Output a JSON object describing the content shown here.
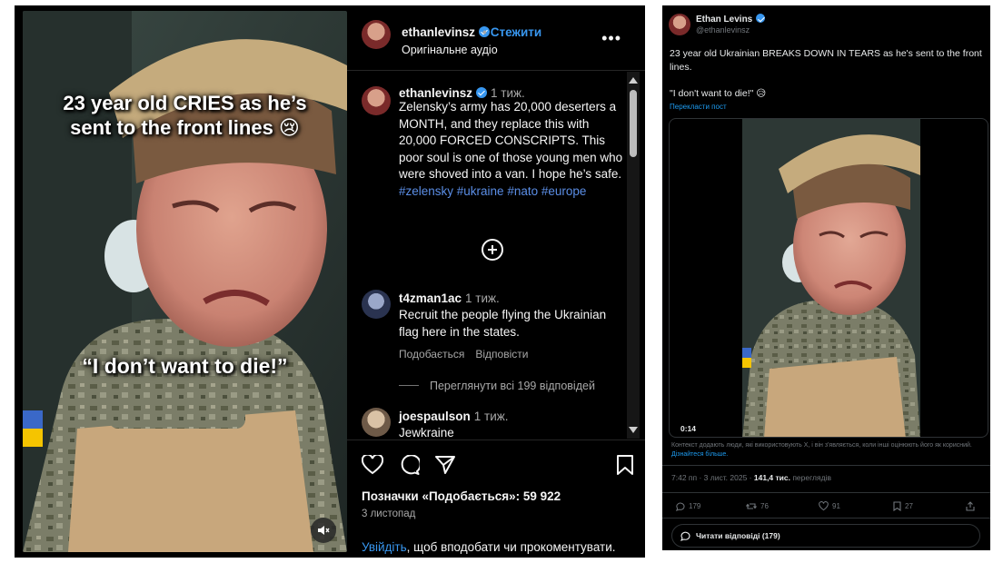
{
  "instagram": {
    "video": {
      "caption_top_line1": "23 year old CRIES as he’s",
      "caption_top_line2": "sent to the front lines 😢",
      "caption_quote": "“I don’t want to die!”"
    },
    "header": {
      "username": "ethanlevinsz",
      "follow_label": "Стежити",
      "audio_label": "Оригінальне аудіо",
      "more_icon": "more-horizontal-icon"
    },
    "post": {
      "username": "ethanlevinsz",
      "time": "1 тиж.",
      "caption": "Zelensky’s army has 20,000 deserters a MONTH, and they replace this with 20,000 FORCED CONSCRIPTS. This poor soul is one of those young men who were shoved into a van. I hope he’s safe.",
      "hashtags": "#zelensky #ukraine #nato #europe"
    },
    "comments": [
      {
        "username": "t4zman1ac",
        "time": "1 тиж.",
        "text": "Recruit the people flying the Ukrainian flag here in the states.",
        "like_label": "Подобається",
        "reply_label": "Відповісти",
        "view_replies_label": "Переглянути всі 199 відповідей"
      },
      {
        "username": "joespaulson",
        "time": "1 тиж.",
        "text": "Jewkraine"
      }
    ],
    "footer": {
      "likes_label": "Позначки «Подобається»: 59 922",
      "date": "3 листопад",
      "login_link": "Увійдіть",
      "login_rest": ", щоб вподобати чи прокоментувати."
    }
  },
  "x_post": {
    "display_name": "Ethan Levins",
    "handle": "@ethanlevinsz",
    "text_line1": "23 year old Ukrainian BREAKS DOWN IN TEARS as he's sent to the front lines.",
    "text_line2": "\"I don't want to die!\" 😥",
    "translate_label": "Перекласти пост",
    "video_duration": "0:14",
    "community_note": "Контекст додають люди, які використовують X, і він з'являється, коли інші оцінюють його як корисний.",
    "community_note_link": "Дізнайтеся більше.",
    "meta_time": "7:42 пп · 3 лист. 2025 · ",
    "meta_views": "141,4 тис.",
    "meta_views_label": " переглядів",
    "stats": {
      "replies": "179",
      "reposts": "76",
      "likes": "91",
      "bookmarks": "27"
    },
    "read_replies_label": "Читати відповіді (179)"
  }
}
